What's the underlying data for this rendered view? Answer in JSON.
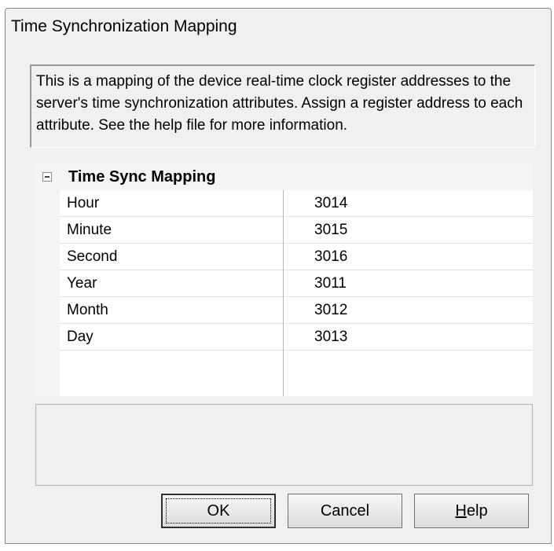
{
  "dialog": {
    "title": "Time Synchronization Mapping",
    "description": "This is a mapping of the device real-time clock register addresses to the server's time synchronization attributes. Assign a register address to each attribute. See the help file for more information."
  },
  "grid": {
    "group_label": "Time Sync Mapping",
    "rows": [
      {
        "name": "Hour",
        "value": "3014"
      },
      {
        "name": "Minute",
        "value": "3015"
      },
      {
        "name": "Second",
        "value": "3016"
      },
      {
        "name": "Year",
        "value": "3011"
      },
      {
        "name": "Month",
        "value": "3012"
      },
      {
        "name": "Day",
        "value": "3013"
      }
    ]
  },
  "buttons": {
    "ok": "OK",
    "cancel": "Cancel",
    "help_mnemonic": "H",
    "help_rest": "elp"
  }
}
